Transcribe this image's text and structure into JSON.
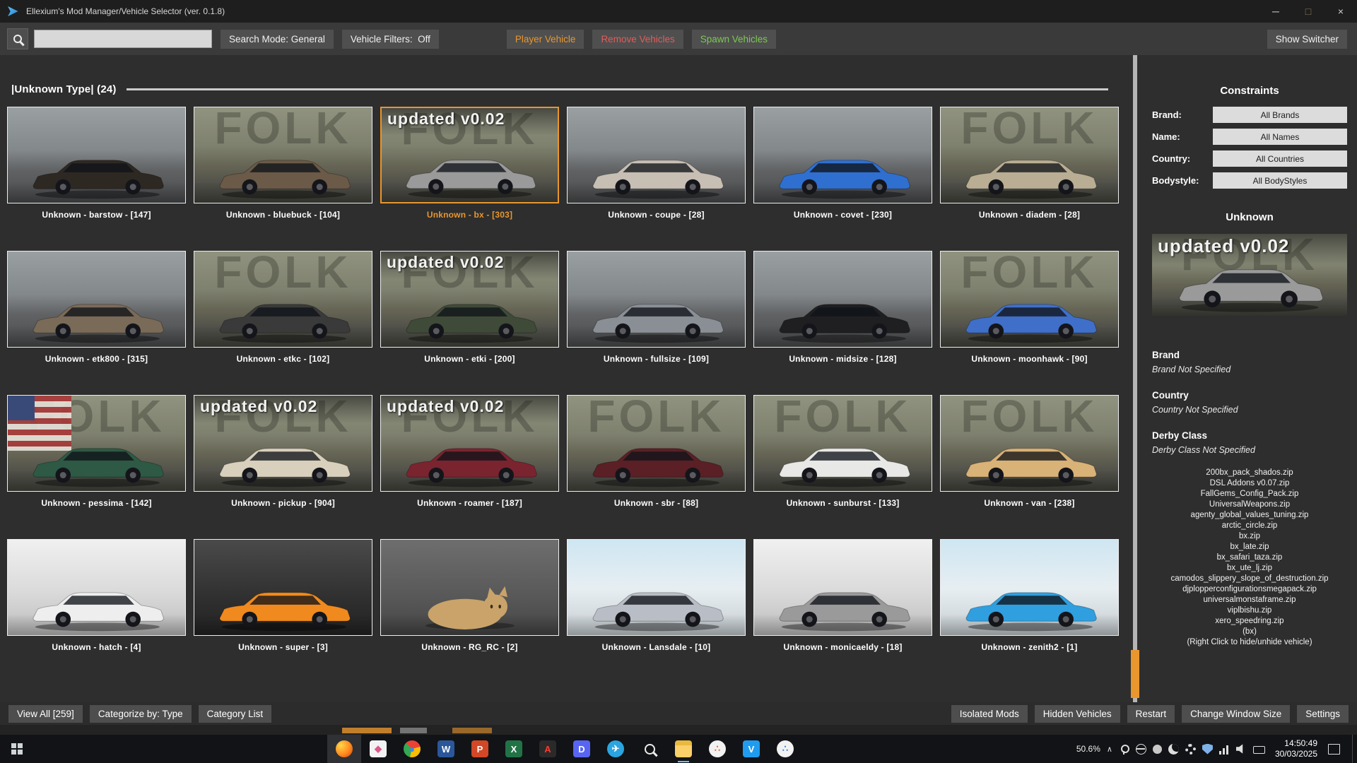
{
  "window": {
    "title": "Ellexium's Mod Manager/Vehicle Selector (ver. 0.1.8)",
    "controls": {
      "minimize": "─",
      "maximize": "□",
      "close": "×"
    }
  },
  "colors": {
    "accent_orange": "#e8962e",
    "remove_red": "#e05c5c",
    "spawn_green": "#7dc855"
  },
  "toolbar": {
    "search_value": "",
    "search_mode": "Search Mode: General",
    "vehicle_filters": "Vehicle Filters:  Off",
    "player_vehicle": "Player Vehicle",
    "remove_vehicles": "Remove Vehicles",
    "spawn_vehicles": "Spawn Vehicles",
    "show_switcher": "Show Switcher"
  },
  "section": {
    "title": "|Unknown Type| (24)"
  },
  "thumb": {
    "banner_text": "updated v0.02",
    "wall_text": "FOLK"
  },
  "vehicles": [
    {
      "label": "Unknown - barstow - [147]",
      "color": "#2e2823",
      "bg": "road"
    },
    {
      "label": "Unknown - bluebuck - [104]",
      "color": "#6b5a48",
      "bg": "wall"
    },
    {
      "label": "Unknown - bx - [303]",
      "color": "#9a9a9a",
      "bg": "wall",
      "banner": true,
      "selected": true
    },
    {
      "label": "Unknown - coupe - [28]",
      "color": "#c7beb4",
      "bg": "road"
    },
    {
      "label": "Unknown - covet - [230]",
      "color": "#2f6fd0",
      "bg": "road"
    },
    {
      "label": "Unknown - diadem - [28]",
      "color": "#b9ad93",
      "bg": "wall"
    },
    {
      "label": "Unknown - etk800 - [315]",
      "color": "#7a6a58",
      "bg": "road"
    },
    {
      "label": "Unknown - etkc - [102]",
      "color": "#3a3a3a",
      "bg": "wall"
    },
    {
      "label": "Unknown - etki - [200]",
      "color": "#3f4a38",
      "bg": "wall",
      "banner": true
    },
    {
      "label": "Unknown - fullsize - [109]",
      "color": "#8a8f96",
      "bg": "road"
    },
    {
      "label": "Unknown - midsize - [128]",
      "color": "#1f1f22",
      "bg": "road"
    },
    {
      "label": "Unknown - moonhawk - [90]",
      "color": "#3f6fc9",
      "bg": "wall"
    },
    {
      "label": "Unknown - pessima - [142]",
      "color": "#2e5945",
      "bg": "flag"
    },
    {
      "label": "Unknown - pickup - [904]",
      "color": "#d8d0bc",
      "bg": "wall",
      "banner": true
    },
    {
      "label": "Unknown - roamer - [187]",
      "color": "#7a2430",
      "bg": "wall",
      "banner": true
    },
    {
      "label": "Unknown - sbr - [88]",
      "color": "#5a2026",
      "bg": "wall"
    },
    {
      "label": "Unknown - sunburst - [133]",
      "color": "#e8e8e6",
      "bg": "wall"
    },
    {
      "label": "Unknown - van - [238]",
      "color": "#d9b277",
      "bg": "wall"
    },
    {
      "label": "Unknown - hatch - [4]",
      "color": "#eeeeee",
      "bg": "light"
    },
    {
      "label": "Unknown - super - [3]",
      "color": "#f08a1e",
      "bg": "dark"
    },
    {
      "label": "Unknown - RG_RC - [2]",
      "color": "#c9a36a",
      "bg": "studio",
      "shape": "cat"
    },
    {
      "label": "Unknown - Lansdale - [10]",
      "color": "#b9bec6",
      "bg": "sky"
    },
    {
      "label": "Unknown - monicaeldy - [18]",
      "color": "#9a9a9a",
      "bg": "light"
    },
    {
      "label": "Unknown - zenith2 - [1]",
      "color": "#2f9fe0",
      "bg": "sky"
    }
  ],
  "sidebar": {
    "constraints_title": "Constraints",
    "constraints": [
      {
        "label": "Brand:",
        "value": "All Brands"
      },
      {
        "label": "Name:",
        "value": "All Names"
      },
      {
        "label": "Country:",
        "value": "All Countries"
      },
      {
        "label": "Bodystyle:",
        "value": "All BodyStyles"
      }
    ],
    "selected_title": "Unknown",
    "preview": {
      "color": "#9a9a9a",
      "bg": "wall",
      "banner": true
    },
    "sections": [
      {
        "heading": "Brand",
        "value": "Brand Not Specified"
      },
      {
        "heading": "Country",
        "value": "Country Not Specified"
      },
      {
        "heading": "Derby Class",
        "value": "Derby Class Not Specified"
      }
    ],
    "files": [
      "200bx_pack_shados.zip",
      "DSL Addons v0.07.zip",
      "FallGems_Config_Pack.zip",
      "UniversalWeapons.zip",
      "agenty_global_values_tuning.zip",
      "arctic_circle.zip",
      "bx.zip",
      "bx_late.zip",
      "bx_safari_taza.zip",
      "bx_ute_lj.zip",
      "camodos_slippery_slope_of_destruction.zip",
      "djplopperconfigurationsmegapack.zip",
      "universalmonstaframe.zip",
      "viplbishu.zip",
      "xero_speedring.zip"
    ],
    "note": "(bx)",
    "hint": "(Right Click to hide/unhide vehicle)"
  },
  "bottombar": {
    "left": [
      "View All [259]",
      "Categorize by: Type",
      "Category List"
    ],
    "right": [
      "Isolated Mods",
      "Hidden Vehicles",
      "Restart",
      "Change Window Size",
      "Settings"
    ]
  },
  "taskbar": {
    "usage": "50.6%",
    "time": "14:50:49",
    "date": "30/03/2025",
    "apps": [
      {
        "name": "firefox",
        "glyph": "",
        "bg": "radial-gradient(circle at 30% 30%, #ffd54a, #ff8a1e 55%, #d63a0e)",
        "circle": true,
        "active": true
      },
      {
        "name": "app-white",
        "glyph": "◆",
        "fg": "#d85a8a",
        "bg": "#f2f2f2"
      },
      {
        "name": "chrome",
        "glyph": "●",
        "fg": "#4285f4",
        "bg": "conic-gradient(from -45deg, #ea4335 0 120deg, #fbbc05 0 240deg, #34a853 0 360deg)",
        "circle": true
      },
      {
        "name": "word",
        "glyph": "W",
        "bg": "#2b579a"
      },
      {
        "name": "powerpoint",
        "glyph": "P",
        "bg": "#d24726"
      },
      {
        "name": "excel",
        "glyph": "X",
        "bg": "#217346"
      },
      {
        "name": "acrobat",
        "glyph": "A",
        "fg": "#ff3b2e",
        "bg": "#2a2a2a"
      },
      {
        "name": "discord",
        "glyph": "D",
        "bg": "#5865f2"
      },
      {
        "name": "telegram",
        "glyph": "✈",
        "bg": "#2aa5e0",
        "circle": true
      },
      {
        "name": "search-app",
        "glyph": "",
        "shape": "mag"
      },
      {
        "name": "file-explorer",
        "glyph": "",
        "bg": "linear-gradient(180deg,#e8b93e 0 30%, #f9d06a 30%)",
        "open": true
      },
      {
        "name": "app-orange-dots",
        "glyph": "∴",
        "fg": "#e8622e",
        "bg": "#f2f2f2",
        "circle": true
      },
      {
        "name": "vscode",
        "glyph": "V",
        "bg": "#1f9cf0"
      },
      {
        "name": "app-blue-dots",
        "glyph": "∴",
        "fg": "#2a7fe0",
        "bg": "#f2f2f2",
        "circle": true
      }
    ]
  }
}
